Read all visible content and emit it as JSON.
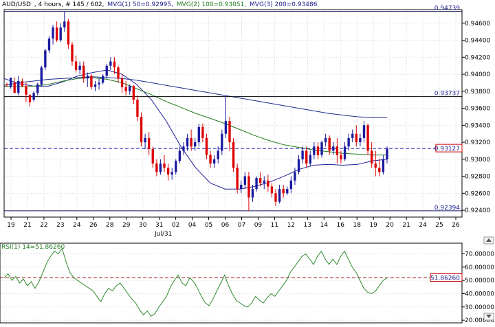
{
  "header": {
    "symbol": "AUD/USD",
    "info": ", 4 hours, # 145 / 602,",
    "ma1": "MVG(1) 50=0.92995,",
    "ma2": "MVG(2) 100=0.93051,",
    "ma3": "MVG(3) 200=0.93486"
  },
  "rsi_header": "RSI(1) 14=51.86260",
  "colors": {
    "background": "#ffffff",
    "frame": "#000000",
    "grid": "#d8d8d8",
    "bull": "#1a1aa0",
    "bear": "#dd0000",
    "ma50": "#1f1f9a",
    "ma100": "#1e7a1e",
    "ma200": "#1a2a8a",
    "hline": "#1a1a6a",
    "current": "#1a1ab0",
    "rsi": "#2e8b2e",
    "rsi_ref": "#8b0000",
    "text_blue": "#1a1a8a",
    "text_green": "#1e7a1e",
    "current_box": "#cc0000"
  },
  "chart_data": [
    {
      "type": "candlestick",
      "title": "AUD/USD , 4 hours, # 145 / 602,",
      "x_ticks": [
        "19",
        "21",
        "22",
        "23",
        "24",
        "26",
        "28",
        "29",
        "30",
        "31",
        "02",
        "04",
        "05",
        "06",
        "07",
        "09",
        "11",
        "12",
        "13",
        "14",
        "16",
        "18",
        "19",
        "20",
        "21",
        "24",
        "25",
        "26"
      ],
      "x_sub_label": "Jul/31",
      "y_ticks": [
        "0.94600",
        "0.94400",
        "0.94200",
        "0.94000",
        "0.93800",
        "0.93600",
        "0.93400",
        "0.93200",
        "0.93000",
        "0.92800",
        "0.92600",
        "0.92400"
      ],
      "ylim": [
        0.9232,
        0.9476
      ],
      "levels": {
        "high": "0.94739",
        "mid": "0.93737",
        "current": "0.93127",
        "low": "0.92394"
      },
      "levels_num": {
        "high": 0.94739,
        "mid": 0.93737,
        "current": 0.93127,
        "low": 0.92394
      },
      "candles": [
        [
          0.9388,
          0.939,
          0.9387,
          0.9385
        ],
        [
          0.9385,
          0.9396,
          0.9396,
          0.9383
        ],
        [
          0.939,
          0.9396,
          0.9378,
          0.9388
        ],
        [
          0.9378,
          0.9398,
          0.9392,
          0.9375
        ],
        [
          0.9392,
          0.9395,
          0.9386,
          0.9385
        ],
        [
          0.9386,
          0.939,
          0.9376,
          0.9367
        ],
        [
          0.9376,
          0.9376,
          0.9367,
          0.9362
        ],
        [
          0.937,
          0.938,
          0.9378,
          0.9368
        ],
        [
          0.9378,
          0.939,
          0.9388,
          0.9375
        ],
        [
          0.9388,
          0.941,
          0.9408,
          0.9385
        ],
        [
          0.9408,
          0.943,
          0.9428,
          0.9405
        ],
        [
          0.9428,
          0.9445,
          0.9442,
          0.9425
        ],
        [
          0.9442,
          0.9458,
          0.9455,
          0.9435
        ],
        [
          0.9455,
          0.9462,
          0.944,
          0.9438
        ],
        [
          0.944,
          0.946,
          0.9455,
          0.9438
        ],
        [
          0.9455,
          0.94739,
          0.9462,
          0.945
        ],
        [
          0.9462,
          0.9465,
          0.9435,
          0.943
        ],
        [
          0.9435,
          0.9438,
          0.9415,
          0.941
        ],
        [
          0.9415,
          0.9422,
          0.9405,
          0.9402
        ],
        [
          0.9405,
          0.9415,
          0.941,
          0.94
        ],
        [
          0.941,
          0.9415,
          0.9395,
          0.939
        ],
        [
          0.9395,
          0.9402,
          0.9398,
          0.9385
        ],
        [
          0.9398,
          0.94,
          0.9385,
          0.9382
        ],
        [
          0.9385,
          0.9392,
          0.9388,
          0.938
        ],
        [
          0.9388,
          0.9395,
          0.939,
          0.9382
        ],
        [
          0.939,
          0.94,
          0.9398,
          0.9388
        ],
        [
          0.9398,
          0.9412,
          0.941,
          0.9395
        ],
        [
          0.941,
          0.942,
          0.9415,
          0.9405
        ],
        [
          0.9415,
          0.942,
          0.9408,
          0.94
        ],
        [
          0.9408,
          0.941,
          0.9395,
          0.939
        ],
        [
          0.9395,
          0.94,
          0.9385,
          0.9378
        ],
        [
          0.9385,
          0.9392,
          0.938,
          0.9375
        ],
        [
          0.938,
          0.9388,
          0.9386,
          0.9376
        ],
        [
          0.9386,
          0.9387,
          0.937,
          0.9365
        ],
        [
          0.937,
          0.9375,
          0.935,
          0.9345
        ],
        [
          0.935,
          0.9355,
          0.932,
          0.9315
        ],
        [
          0.932,
          0.933,
          0.9325,
          0.9312
        ],
        [
          0.9325,
          0.9332,
          0.9312,
          0.9305
        ],
        [
          0.9312,
          0.9315,
          0.9295,
          0.929
        ],
        [
          0.9295,
          0.93,
          0.9285,
          0.928
        ],
        [
          0.9285,
          0.93,
          0.9295,
          0.9282
        ],
        [
          0.9295,
          0.9305,
          0.929,
          0.9285
        ],
        [
          0.929,
          0.9295,
          0.9282,
          0.9275
        ],
        [
          0.9282,
          0.929,
          0.9285,
          0.9276
        ],
        [
          0.9285,
          0.93,
          0.9298,
          0.9282
        ],
        [
          0.9298,
          0.9315,
          0.931,
          0.9295
        ],
        [
          0.931,
          0.932,
          0.9315,
          0.9305
        ],
        [
          0.9315,
          0.933,
          0.9325,
          0.931
        ],
        [
          0.9325,
          0.9335,
          0.9315,
          0.931
        ],
        [
          0.9315,
          0.9325,
          0.932,
          0.931
        ],
        [
          0.932,
          0.9342,
          0.9338,
          0.9315
        ],
        [
          0.9338,
          0.9342,
          0.9325,
          0.932
        ],
        [
          0.9325,
          0.933,
          0.9305,
          0.93
        ],
        [
          0.9305,
          0.931,
          0.9295,
          0.929
        ],
        [
          0.9295,
          0.9305,
          0.93,
          0.929
        ],
        [
          0.93,
          0.9315,
          0.931,
          0.9295
        ],
        [
          0.931,
          0.9335,
          0.933,
          0.9305
        ],
        [
          0.933,
          0.93737,
          0.9345,
          0.9325
        ],
        [
          0.9345,
          0.935,
          0.932,
          0.931
        ],
        [
          0.932,
          0.9325,
          0.929,
          0.9285
        ],
        [
          0.929,
          0.9295,
          0.9265,
          0.926
        ],
        [
          0.9265,
          0.9275,
          0.927,
          0.926
        ],
        [
          0.927,
          0.9285,
          0.928,
          0.9265
        ],
        [
          0.928,
          0.9285,
          0.9255,
          0.92394
        ],
        [
          0.9255,
          0.927,
          0.9265,
          0.925
        ],
        [
          0.9265,
          0.928,
          0.9278,
          0.9262
        ],
        [
          0.9278,
          0.9285,
          0.9272,
          0.9268
        ],
        [
          0.9272,
          0.928,
          0.9275,
          0.9265
        ],
        [
          0.9275,
          0.9282,
          0.9268,
          0.9262
        ],
        [
          0.9268,
          0.9272,
          0.926,
          0.9255
        ],
        [
          0.926,
          0.9265,
          0.925,
          0.9245
        ],
        [
          0.925,
          0.927,
          0.9265,
          0.9248
        ],
        [
          0.9265,
          0.927,
          0.926,
          0.9255
        ],
        [
          0.926,
          0.9268,
          0.9265,
          0.9258
        ],
        [
          0.9265,
          0.928,
          0.9275,
          0.926
        ],
        [
          0.9275,
          0.929,
          0.9285,
          0.927
        ],
        [
          0.9285,
          0.9305,
          0.93,
          0.9282
        ],
        [
          0.93,
          0.9315,
          0.931,
          0.9295
        ],
        [
          0.931,
          0.9315,
          0.9295,
          0.929
        ],
        [
          0.9295,
          0.931,
          0.9305,
          0.9292
        ],
        [
          0.9305,
          0.932,
          0.9315,
          0.93
        ],
        [
          0.9315,
          0.932,
          0.9305,
          0.93
        ],
        [
          0.9305,
          0.9322,
          0.932,
          0.9302
        ],
        [
          0.932,
          0.933,
          0.9325,
          0.9315
        ],
        [
          0.9325,
          0.9328,
          0.931,
          0.9305
        ],
        [
          0.931,
          0.932,
          0.9315,
          0.9305
        ],
        [
          0.9315,
          0.9325,
          0.9305,
          0.9295
        ],
        [
          0.9305,
          0.931,
          0.93,
          0.9295
        ],
        [
          0.93,
          0.932,
          0.9315,
          0.9298
        ],
        [
          0.9315,
          0.933,
          0.9325,
          0.931
        ],
        [
          0.9325,
          0.9335,
          0.933,
          0.932
        ],
        [
          0.933,
          0.934,
          0.932,
          0.9315
        ],
        [
          0.932,
          0.933,
          0.9325,
          0.9315
        ],
        [
          0.9325,
          0.9345,
          0.934,
          0.932
        ],
        [
          0.934,
          0.9342,
          0.931,
          0.9305
        ],
        [
          0.931,
          0.932,
          0.9295,
          0.929
        ],
        [
          0.9295,
          0.931,
          0.929,
          0.928
        ],
        [
          0.929,
          0.93,
          0.9285,
          0.928
        ],
        [
          0.9285,
          0.9305,
          0.93,
          0.9282
        ],
        [
          0.93,
          0.9315,
          0.93127,
          0.9295
        ]
      ],
      "series": [
        {
          "name": "MVG(1) 50",
          "values": [
            0.9395,
            0.9389,
            0.9386,
            0.9386,
            0.9391,
            0.9398,
            0.9402,
            0.9405,
            0.94,
            0.9388,
            0.937,
            0.9345,
            0.9315,
            0.929,
            0.9272,
            0.9265,
            0.9265,
            0.9268,
            0.9273,
            0.928,
            0.9288,
            0.9293,
            0.9294,
            0.9293,
            0.9294,
            0.9298,
            0.93
          ]
        },
        {
          "name": "MVG(2) 100",
          "values": [
            0.9386,
            0.9385,
            0.9386,
            0.9388,
            0.9392,
            0.9395,
            0.9396,
            0.9394,
            0.939,
            0.9383,
            0.9376,
            0.9368,
            0.9361,
            0.9354,
            0.9348,
            0.9342,
            0.9335,
            0.9328,
            0.9322,
            0.9317,
            0.9314,
            0.9311,
            0.9309,
            0.9307,
            0.9306,
            0.9305,
            0.9305
          ]
        },
        {
          "name": "MVG(3) 200",
          "values": [
            0.9387,
            0.939,
            0.9392,
            0.9394,
            0.9395,
            0.9396,
            0.9397,
            0.9396,
            0.9395,
            0.9393,
            0.939,
            0.9387,
            0.9384,
            0.9381,
            0.9378,
            0.9375,
            0.9372,
            0.9369,
            0.9366,
            0.9363,
            0.936,
            0.9357,
            0.9354,
            0.9352,
            0.935,
            0.9349,
            0.9349
          ]
        }
      ]
    },
    {
      "type": "line",
      "title": "RSI(1) 14=51.86260",
      "y_ticks": [
        "70.00000",
        "60.00000",
        "50.00000",
        "40.00000",
        "30.00000",
        "20.00000"
      ],
      "ylim": [
        18,
        78
      ],
      "current_label": "51.86260",
      "current_value": 51.8626,
      "series": [
        {
          "name": "RSI(1) 14",
          "values": [
            52,
            55,
            50,
            53,
            48,
            51,
            46,
            49,
            44,
            49,
            56,
            63,
            68,
            72,
            70,
            74,
            64,
            56,
            52,
            50,
            48,
            46,
            44,
            42,
            38,
            34,
            40,
            44,
            42,
            46,
            48,
            44,
            40,
            36,
            33,
            28,
            24,
            27,
            23,
            25,
            30,
            34,
            38,
            45,
            50,
            54,
            48,
            46,
            52,
            49,
            44,
            38,
            33,
            31,
            36,
            42,
            48,
            54,
            46,
            40,
            35,
            33,
            31,
            30,
            33,
            38,
            35,
            33,
            37,
            40,
            38,
            42,
            46,
            50,
            56,
            60,
            64,
            68,
            70,
            66,
            62,
            68,
            72,
            66,
            62,
            66,
            62,
            68,
            72,
            66,
            60,
            56,
            50,
            44,
            41,
            40,
            42,
            46,
            50,
            52
          ]
        }
      ]
    }
  ]
}
